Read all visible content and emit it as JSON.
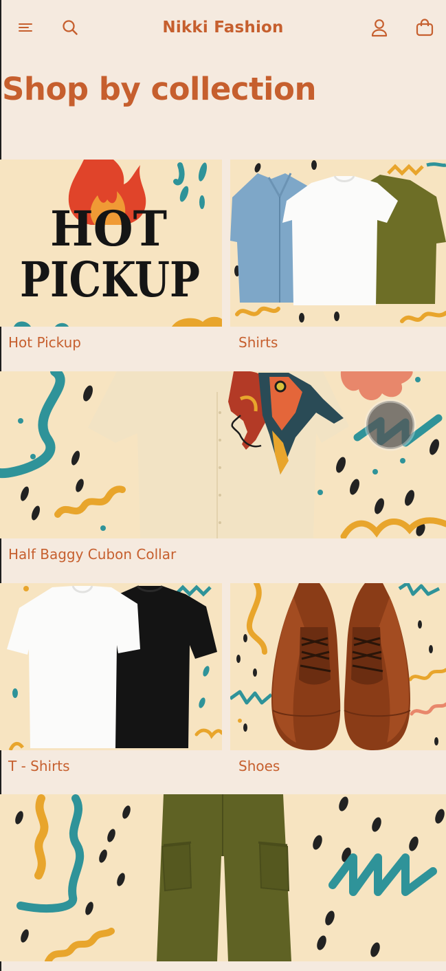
{
  "header": {
    "brand": "Nikki Fashion",
    "icons": [
      "menu-icon",
      "search-icon",
      "account-icon",
      "cart-icon"
    ]
  },
  "page": {
    "title": "Shop by collection"
  },
  "collections": [
    {
      "label": "Hot Pickup",
      "banner_line1": "HOT",
      "banner_line2": "PICKUP"
    },
    {
      "label": "Shirts"
    },
    {
      "label": "Half Baggy Cubon Collar"
    },
    {
      "label": "T - Shirts"
    },
    {
      "label": "Shoes"
    },
    {
      "label": ""
    }
  ],
  "colors": {
    "accent": "#c65f2e",
    "background": "#f5eadf",
    "card_bg": "#f7e4c1",
    "teal": "#2f9399",
    "mustard": "#e8a52c",
    "olive": "#6d6e26"
  }
}
